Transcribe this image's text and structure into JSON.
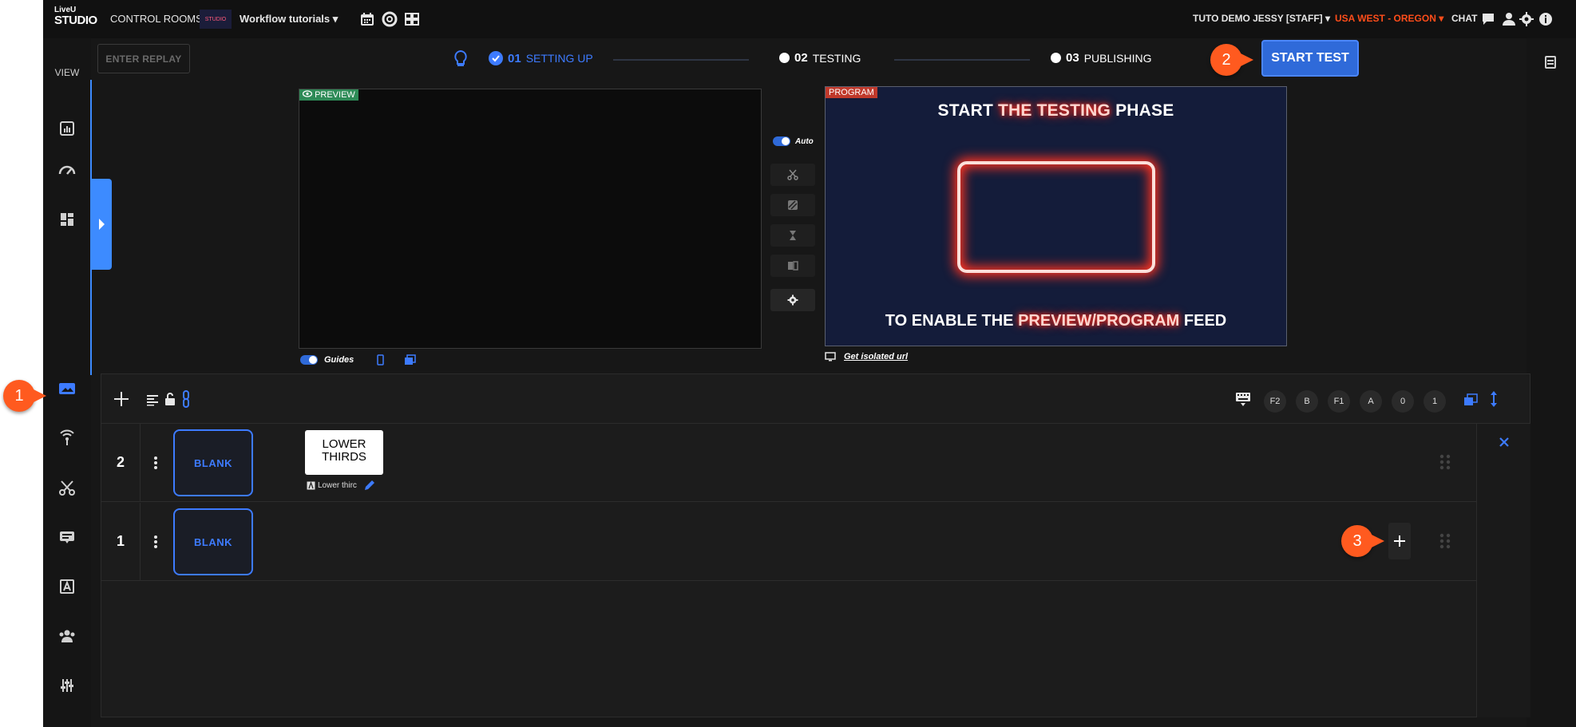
{
  "topbar": {
    "logo_line1": "LiveU",
    "logo_line2": "STUDIO",
    "control_rooms": "CONTROL ROOMS",
    "thumb_text": "STUDIO",
    "project": "Workflow tutorials",
    "user": "TUTO DEMO JESSY [STAFF]",
    "region": "USA WEST - OREGON",
    "chat": "CHAT"
  },
  "sidebar": {
    "view_label": "VIEW"
  },
  "stepper": {
    "enter_replay": "ENTER REPLAY",
    "step1_num": "01",
    "step1_label": "SETTING UP",
    "step2_num": "02",
    "step2_label": "TESTING",
    "step3_num": "03",
    "step3_label": "PUBLISHING",
    "start_test": "START TEST"
  },
  "preview": {
    "tag": "PREVIEW",
    "guides_label": "Guides"
  },
  "program": {
    "tag": "PROGRAM",
    "line1_a": "START ",
    "line1_hl": "THE TESTING",
    "line1_b": " PHASE",
    "line2_a": "TO ENABLE THE ",
    "line2_hl": "PREVIEW/PROGRAM",
    "line2_b": " FEED",
    "isolated_url": "Get isolated url"
  },
  "controls": {
    "auto_label": "Auto"
  },
  "layers_toolbar": {
    "keys": [
      "F2",
      "B",
      "F1",
      "A",
      "0",
      "1"
    ]
  },
  "layers": [
    {
      "number": "2",
      "tile": "BLANK",
      "graphic_title": "LOWER THIRDS",
      "graphic_caption": "Lower thirc"
    },
    {
      "number": "1",
      "tile": "BLANK"
    }
  ],
  "callouts": [
    "1",
    "2",
    "3"
  ],
  "colors": {
    "accent": "#2f6ad9",
    "region": "#ff4d1a",
    "callout": "#ff5a1f",
    "preview_tag": "#2e8b57",
    "program_tag": "#c0392b"
  }
}
